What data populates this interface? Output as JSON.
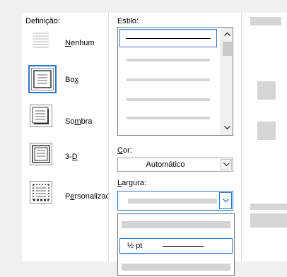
{
  "setting": {
    "label": "Definição:",
    "presets": [
      {
        "label_pre": "",
        "label_ul": "N",
        "label_post": "enhum",
        "icon": "none-border-icon"
      },
      {
        "label_pre": "Bo",
        "label_ul": "x",
        "label_post": "",
        "icon": "box-border-icon",
        "selected": true
      },
      {
        "label_pre": "So",
        "label_ul": "m",
        "label_post": "bra",
        "icon": "shadow-border-icon"
      },
      {
        "label_pre": "3-",
        "label_ul": "D",
        "label_post": "",
        "icon": "3d-border-icon"
      },
      {
        "label_pre": "P",
        "label_ul": "e",
        "label_post": "rsonalizado",
        "icon": "custom-border-icon"
      }
    ]
  },
  "style": {
    "label": "Estilo:",
    "scroll_up_icon": "chevron-up-icon",
    "scroll_down_icon": "chevron-down-icon"
  },
  "color": {
    "label_ul": "C",
    "label_post": "or:",
    "value": "Automático",
    "dropdown_icon": "chevron-down-icon"
  },
  "width": {
    "label_ul": "L",
    "label_post": "argura:",
    "dropdown_icon": "chevron-down-icon",
    "selected_option": "½ pt"
  },
  "colors": {
    "accent": "#2f73c8",
    "panel": "#ffffff",
    "background": "#f0f0f0",
    "placeholder": "#d6d6d6"
  }
}
